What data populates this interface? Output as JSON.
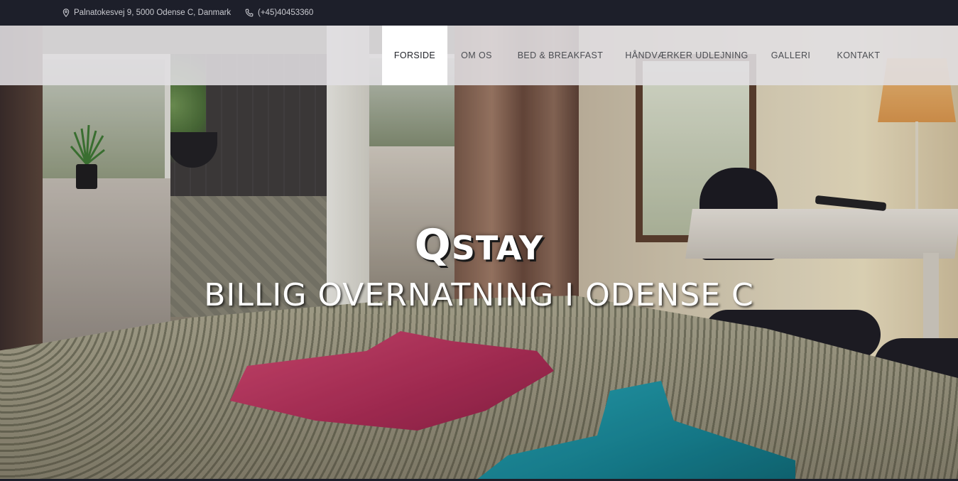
{
  "topbar": {
    "address": "Palnatokesvej 9, 5000 Odense C, Danmark",
    "phone": "(+45)40453360",
    "address_icon": "map-pin-icon",
    "phone_icon": "phone-icon"
  },
  "nav": {
    "items": [
      {
        "label": "FORSIDE",
        "active": true
      },
      {
        "label": "OM OS"
      },
      {
        "label": "BED & BREAKFAST"
      },
      {
        "label": "HÅNDVÆRKER UDLEJNING"
      },
      {
        "label": "GALLERI"
      },
      {
        "label": "KONTAKT"
      }
    ]
  },
  "hero": {
    "logo_first": "Q",
    "logo_rest": "STAY",
    "tagline": "BILLIG OVERNATNING I ODENSE C"
  },
  "colors": {
    "topbar_bg": "#1d1f2a",
    "nav_bg": "#e1dfe2",
    "nav_active_bg": "#ffffff",
    "text_light": "#ffffff"
  }
}
